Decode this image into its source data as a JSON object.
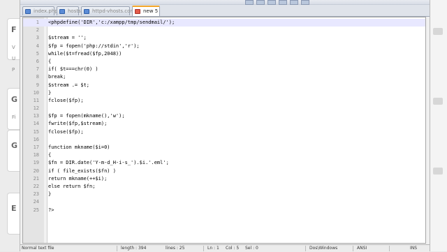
{
  "background_left": {
    "letters": [
      "F",
      "V",
      "U",
      "P",
      "G",
      "Fi",
      "G",
      "E"
    ]
  },
  "tabs": [
    {
      "label": "index.php",
      "active": false,
      "icon": "file-saved-icon"
    },
    {
      "label": "hosts",
      "active": false,
      "icon": "file-saved-icon"
    },
    {
      "label": "httpd-vhosts.conf",
      "active": false,
      "icon": "file-saved-icon"
    },
    {
      "label": "new 5",
      "active": true,
      "icon": "file-modified-icon"
    }
  ],
  "editor": {
    "current_line": 1,
    "lines": [
      {
        "n": "1",
        "text": "<phpdefine('DIR','c:/xampp/tmp/sendmail/');"
      },
      {
        "n": "2",
        "text": ""
      },
      {
        "n": "3",
        "text": "$stream = '';"
      },
      {
        "n": "4",
        "text": "$fp = fopen('php://stdin','r');"
      },
      {
        "n": "5",
        "text": "while($t=fread($fp,2048))"
      },
      {
        "n": "6",
        "text": "{"
      },
      {
        "n": "7",
        "text": "if( $t===chr(0) )"
      },
      {
        "n": "8",
        "text": "break;"
      },
      {
        "n": "9",
        "text": "$stream .= $t;"
      },
      {
        "n": "10",
        "text": "}"
      },
      {
        "n": "11",
        "text": "fclose($fp);"
      },
      {
        "n": "12",
        "text": ""
      },
      {
        "n": "13",
        "text": "$fp = fopen(mkname(),'w');"
      },
      {
        "n": "14",
        "text": "fwrite($fp,$stream);"
      },
      {
        "n": "15",
        "text": "fclose($fp);"
      },
      {
        "n": "16",
        "text": ""
      },
      {
        "n": "17",
        "text": "function mkname($i=0)"
      },
      {
        "n": "18",
        "text": "{"
      },
      {
        "n": "19",
        "text": "$fn = DIR.date('Y-m-d_H-i-s_').$i.'.eml';"
      },
      {
        "n": "20",
        "text": "if ( file_exists($fn) )"
      },
      {
        "n": "21",
        "text": "return mkname(++$i);"
      },
      {
        "n": "22",
        "text": "else return $fn;"
      },
      {
        "n": "23",
        "text": "}"
      },
      {
        "n": "24",
        "text": ""
      },
      {
        "n": "25",
        "text": "?>"
      }
    ]
  },
  "status": {
    "file_type": "Normal text file",
    "length": "length : 394",
    "lines": "lines : 25",
    "ln": "Ln : 1",
    "col": "Col : 5",
    "sel": "Sel : 0",
    "eol": "Dos\\Windows",
    "encoding": "ANSI",
    "mode": "INS"
  }
}
